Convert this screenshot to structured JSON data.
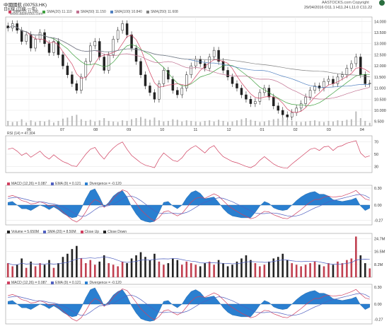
{
  "header": {
    "title": "中國國航 (00753.HK)",
    "period": "日K線 (日線·一年)",
    "domain": "www.aastocks.com",
    "source": "AASTOCKS.com Copyright",
    "ohlc": "29/04/2016  O11.1  H11.24  L11.0  C11.22"
  },
  "price_legend": [
    {
      "label": "SMA(10) 11.050",
      "color": "#d04060"
    },
    {
      "label": "SMA(20) 11.110",
      "color": "#40a040"
    },
    {
      "label": "SMA(50) 11.150",
      "color": "#c07090"
    },
    {
      "label": "SMA(100) 10.840",
      "color": "#5080c0"
    },
    {
      "label": "SMA(250) 11.608",
      "color": "#808080"
    }
  ],
  "rsi_legend": "RSI (14) = 47.304",
  "macd_legend": [
    {
      "label": "MACD (12,26) = 0.087",
      "color": "#d04060"
    },
    {
      "label": "EMA (9) = 0.121",
      "color": "#5060c0"
    },
    {
      "label": "Divergence = -0.120",
      "color": "#2a7fd0"
    }
  ],
  "vol_legend": [
    {
      "label": "Volume = 5.650M",
      "color": "#222222"
    },
    {
      "label": "SMA (20) = 8.50M",
      "color": "#5060c0"
    },
    {
      "label": "Close Up",
      "color": "#d04060"
    },
    {
      "label": "Close Down",
      "color": "#222222"
    }
  ],
  "macd2_legend": [
    {
      "label": "MACD (12,26) = 0.087",
      "color": "#d04060"
    },
    {
      "label": "EMA (9) = 0.121",
      "color": "#5060c0"
    },
    {
      "label": "Divergence = -0.120",
      "color": "#2a7fd0"
    }
  ],
  "chart_data": [
    {
      "type": "candlestick",
      "title": "中國國航 (00753.HK)",
      "x_ticks": [
        "06",
        "07",
        "08",
        "09",
        "10",
        "11",
        "12",
        "01",
        "02",
        "03",
        "04"
      ],
      "y_ticks": [
        14.0,
        13.5,
        13.0,
        12.5,
        12.0,
        11.5,
        11.0,
        10.5,
        10.0,
        9.5
      ],
      "ylim": [
        9.3,
        14.2
      ],
      "close": [
        13.7,
        13.9,
        13.6,
        13.1,
        13.4,
        12.8,
        13.2,
        13.5,
        13.0,
        12.6,
        13.1,
        12.5,
        12.0,
        11.6,
        11.2,
        10.9,
        11.5,
        12.2,
        12.9,
        13.1,
        12.4,
        11.8,
        12.5,
        13.2,
        13.6,
        13.9,
        13.4,
        12.8,
        12.2,
        11.6,
        11.1,
        10.8,
        10.5,
        11.2,
        11.8,
        11.4,
        10.9,
        10.7,
        11.0,
        11.6,
        12.0,
        12.3,
        12.1,
        11.9,
        12.4,
        12.7,
        12.2,
        11.8,
        11.5,
        11.2,
        11.0,
        10.7,
        10.5,
        10.3,
        10.4,
        10.8,
        11.0,
        10.6,
        10.2,
        10.0,
        9.8,
        9.7,
        9.9,
        10.1,
        10.3,
        10.6,
        10.9,
        11.1,
        11.0,
        11.3,
        11.4,
        11.2,
        11.5,
        11.6,
        11.9,
        12.1,
        12.4,
        11.6,
        11.2,
        11.22
      ],
      "grid": true
    },
    {
      "type": "line",
      "title": "RSI (14) = 47.304",
      "y_ticks": [
        70,
        50,
        30
      ],
      "ylim": [
        20,
        80
      ],
      "series": [
        {
          "name": "RSI (14)",
          "values": [
            58,
            60,
            55,
            48,
            52,
            45,
            50,
            55,
            47,
            42,
            49,
            43,
            38,
            35,
            31,
            30,
            40,
            50,
            58,
            61,
            50,
            42,
            52,
            60,
            66,
            70,
            58,
            48,
            42,
            36,
            32,
            30,
            28,
            42,
            52,
            46,
            40,
            38,
            44,
            54,
            60,
            64,
            58,
            52,
            60,
            64,
            54,
            46,
            42,
            38,
            36,
            33,
            30,
            28,
            32,
            40,
            46,
            40,
            34,
            30,
            28,
            27,
            34,
            40,
            46,
            52,
            58,
            60,
            56,
            62,
            63,
            56,
            62,
            64,
            68,
            70,
            72,
            52,
            45,
            47.3
          ]
        }
      ],
      "grid": true
    },
    {
      "type": "line",
      "title": "MACD (12,26)",
      "y_ticks": [
        0.3,
        0.0,
        -0.27
      ],
      "ylim": [
        -0.35,
        0.35
      ],
      "series": [
        {
          "name": "MACD (12,26)",
          "values": [
            0.15,
            0.17,
            0.14,
            0.08,
            0.06,
            0.02,
            0.03,
            0.06,
            0.03,
            -0.02,
            0.0,
            -0.05,
            -0.12,
            -0.19,
            -0.26,
            -0.3,
            -0.24,
            -0.12,
            0.02,
            0.1,
            0.06,
            -0.04,
            0.02,
            0.12,
            0.2,
            0.27,
            0.24,
            0.14,
            0.03,
            -0.08,
            -0.16,
            -0.23,
            -0.28,
            -0.22,
            -0.12,
            -0.1,
            -0.15,
            -0.19,
            -0.15,
            -0.05,
            0.05,
            0.12,
            0.14,
            0.12,
            0.16,
            0.2,
            0.16,
            0.08,
            0.0,
            -0.06,
            -0.11,
            -0.16,
            -0.2,
            -0.24,
            -0.22,
            -0.16,
            -0.11,
            -0.12,
            -0.17,
            -0.2,
            -0.23,
            -0.24,
            -0.2,
            -0.14,
            -0.08,
            -0.01,
            0.05,
            0.1,
            0.1,
            0.14,
            0.16,
            0.14,
            0.15,
            0.16,
            0.19,
            0.22,
            0.26,
            0.18,
            0.11,
            0.087
          ]
        },
        {
          "name": "EMA (9)",
          "values": [
            0.12,
            0.13,
            0.14,
            0.12,
            0.1,
            0.08,
            0.06,
            0.06,
            0.05,
            0.03,
            0.02,
            0.0,
            -0.03,
            -0.07,
            -0.12,
            -0.17,
            -0.2,
            -0.19,
            -0.14,
            -0.08,
            -0.03,
            -0.02,
            -0.01,
            0.02,
            0.06,
            0.11,
            0.15,
            0.16,
            0.13,
            0.08,
            0.02,
            -0.04,
            -0.1,
            -0.14,
            -0.15,
            -0.14,
            -0.14,
            -0.15,
            -0.15,
            -0.13,
            -0.09,
            -0.04,
            0.01,
            0.05,
            0.08,
            0.11,
            0.13,
            0.12,
            0.09,
            0.06,
            0.02,
            -0.02,
            -0.06,
            -0.1,
            -0.14,
            -0.15,
            -0.15,
            -0.14,
            -0.14,
            -0.15,
            -0.17,
            -0.19,
            -0.2,
            -0.19,
            -0.17,
            -0.13,
            -0.09,
            -0.05,
            -0.02,
            0.02,
            0.06,
            0.08,
            0.1,
            0.12,
            0.14,
            0.16,
            0.18,
            0.19,
            0.17,
            0.121
          ]
        }
      ],
      "grid": true
    },
    {
      "type": "bar",
      "title": "Volume = 5.650M",
      "y_ticks": [
        "24.7M",
        "16.5M",
        "8.2M"
      ],
      "ylim": [
        0,
        28
      ],
      "values": [
        9,
        7,
        8,
        12,
        6,
        10,
        7,
        9,
        8,
        11,
        6,
        9,
        13,
        15,
        18,
        20,
        12,
        9,
        11,
        8,
        10,
        14,
        9,
        8,
        7,
        10,
        9,
        12,
        14,
        16,
        13,
        11,
        15,
        10,
        8,
        9,
        12,
        11,
        8,
        10,
        9,
        8,
        7,
        9,
        10,
        8,
        11,
        9,
        7,
        8,
        10,
        12,
        14,
        11,
        9,
        7,
        8,
        10,
        12,
        13,
        15,
        11,
        9,
        8,
        7,
        8,
        9,
        10,
        8,
        7,
        9,
        8,
        10,
        9,
        11,
        12,
        26,
        14,
        9,
        5.65
      ],
      "grid": true
    }
  ]
}
